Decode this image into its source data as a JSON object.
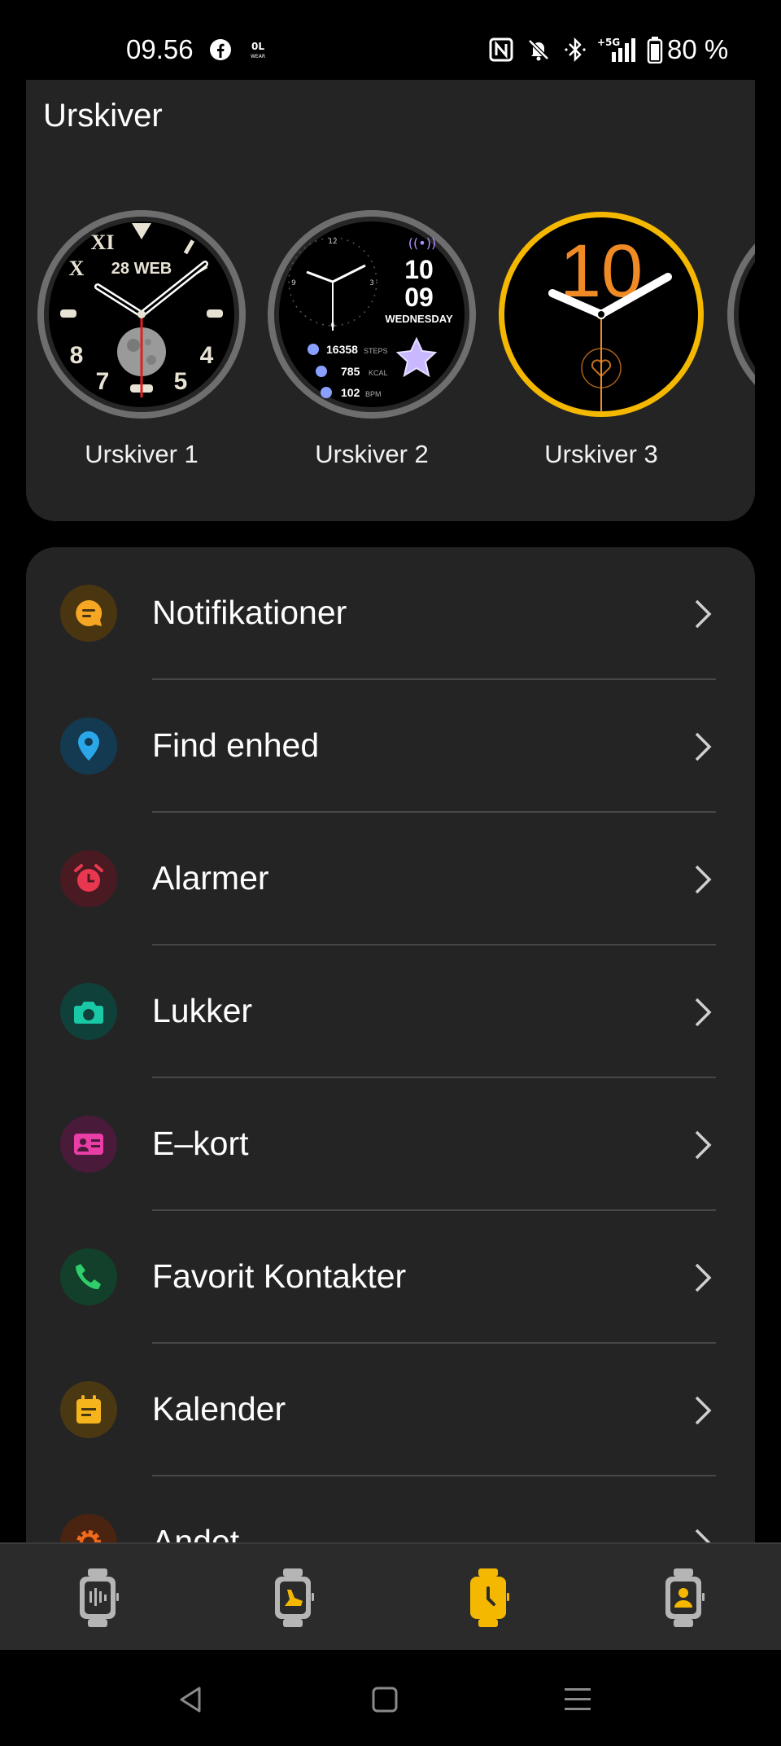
{
  "status_bar": {
    "time": "09.56",
    "battery": "80 %",
    "icons": [
      "facebook-icon",
      "wear-app-icon",
      "nfc-icon",
      "muted-bell-icon",
      "bluetooth-icon",
      "5g-signal-icon",
      "battery-icon"
    ]
  },
  "watch_faces": {
    "title": "Urskiver",
    "items": [
      {
        "label": "Urskiver 1",
        "date": "28 WEB",
        "numerals": [
          "XI",
          "X",
          "8",
          "7",
          "5",
          "4"
        ]
      },
      {
        "label": "Urskiver 2",
        "hour": "10",
        "minute": "09",
        "weekday": "WEDNESDAY",
        "steps": "16358",
        "steps_unit": "STEPS",
        "kcal": "785",
        "kcal_unit": "KCAL",
        "bpm": "102",
        "bpm_unit": "BPM"
      },
      {
        "label": "Urskiver 3",
        "hour": "10",
        "selected": true
      }
    ],
    "accent": "#f5b800"
  },
  "menu": {
    "items": [
      {
        "label": "Notifikationer",
        "icon": "message-icon",
        "color": "#f5a623"
      },
      {
        "label": "Find enhed",
        "icon": "location-pin-icon",
        "color": "#2aa7e8"
      },
      {
        "label": "Alarmer",
        "icon": "alarm-clock-icon",
        "color": "#e8384f"
      },
      {
        "label": "Lukker",
        "icon": "camera-icon",
        "color": "#19c9a6"
      },
      {
        "label": "E–kort",
        "icon": "id-card-icon",
        "color": "#e83ea6"
      },
      {
        "label": "Favorit Kontakter",
        "icon": "phone-icon",
        "color": "#2fce6a"
      },
      {
        "label": "Kalender",
        "icon": "calendar-icon",
        "color": "#f5b41c"
      },
      {
        "label": "Andet",
        "icon": "gear-icon",
        "color": "#f06a1a"
      }
    ]
  },
  "tab_bar": {
    "tabs": [
      {
        "icon": "watch-activity-icon",
        "active": false
      },
      {
        "icon": "watch-workout-icon",
        "active": false
      },
      {
        "icon": "watch-clock-icon",
        "active": true
      },
      {
        "icon": "watch-profile-icon",
        "active": false
      }
    ],
    "active_color": "#f5b800"
  },
  "system_nav": {
    "buttons": [
      "back-icon",
      "home-icon",
      "recents-icon"
    ]
  }
}
